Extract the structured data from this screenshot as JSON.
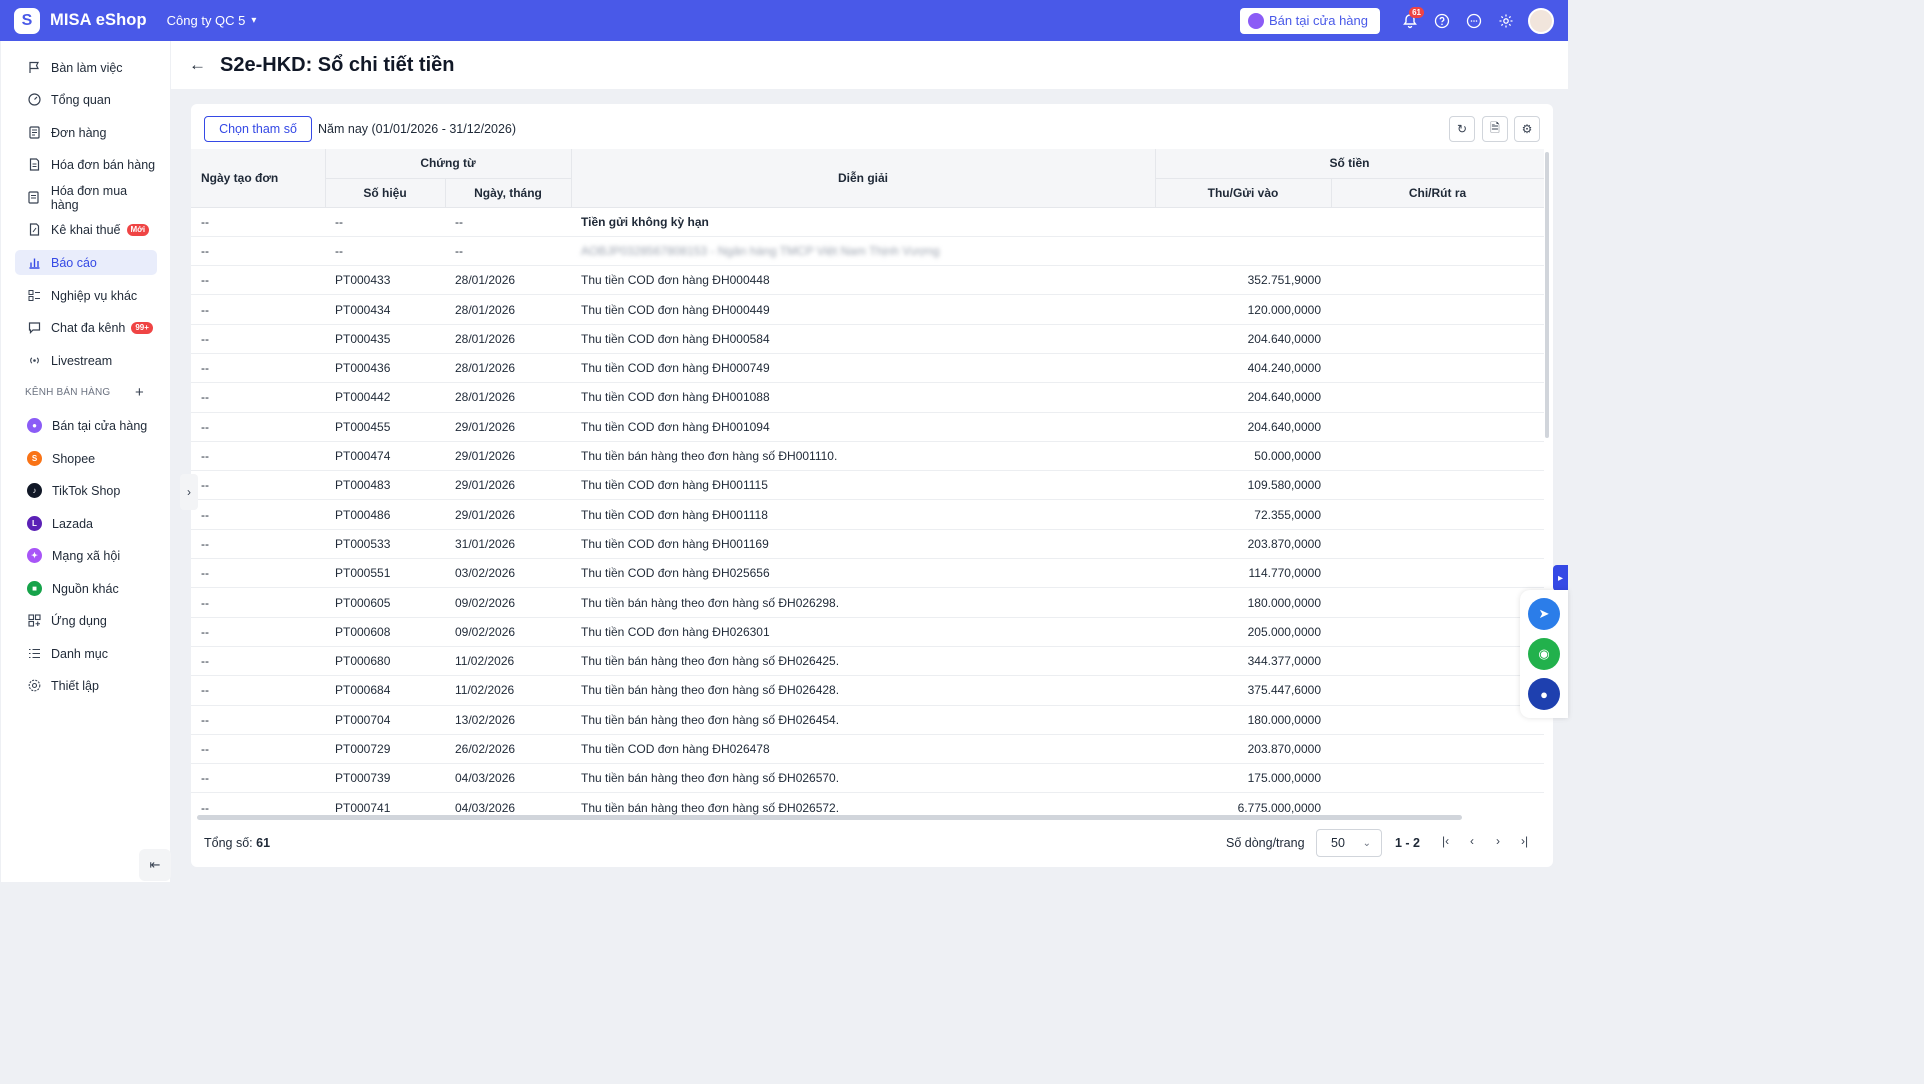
{
  "app": {
    "name": "MISA eShop",
    "company": "Công ty QC 5",
    "store_button": "Bán tại cửa hàng",
    "notif_count": "61"
  },
  "sidebar": {
    "items": [
      {
        "label": "Bàn làm việc"
      },
      {
        "label": "Tổng quan"
      },
      {
        "label": "Đơn hàng"
      },
      {
        "label": "Hóa đơn bán hàng"
      },
      {
        "label": "Hóa đơn mua hàng"
      },
      {
        "label": "Kê khai thuế",
        "badge": "Mới"
      },
      {
        "label": "Báo cáo"
      },
      {
        "label": "Nghiệp vụ khác"
      },
      {
        "label": "Chat đa kênh",
        "badge": "99+"
      },
      {
        "label": "Livestream"
      }
    ],
    "section_label": "KÊNH BÁN HÀNG",
    "channels": [
      {
        "label": "Bán tại cửa hàng",
        "color": "#8b5cf6"
      },
      {
        "label": "Shopee",
        "color": "#f97316"
      },
      {
        "label": "TikTok Shop",
        "color": "#111827"
      },
      {
        "label": "Lazada",
        "color": "#5b21b6"
      },
      {
        "label": "Mạng xã hội",
        "color": "#a855f7"
      },
      {
        "label": "Nguồn khác",
        "color": "#16a34a"
      }
    ],
    "bottom_items": [
      {
        "label": "Ứng dụng"
      },
      {
        "label": "Danh mục"
      },
      {
        "label": "Thiết lập"
      }
    ]
  },
  "page": {
    "title": "S2e-HKD: Sổ chi tiết tiền",
    "param_button": "Chọn tham số",
    "period": "Năm nay (01/01/2026 - 31/12/2026)"
  },
  "table": {
    "headers": {
      "date_created": "Ngày tạo đơn",
      "voucher": "Chứng từ",
      "voucher_no": "Số hiệu",
      "voucher_date": "Ngày, tháng",
      "description": "Diễn giải",
      "amount": "Số tiền",
      "income": "Thu/Gửi vào",
      "expense": "Chi/Rút ra"
    },
    "rows": [
      {
        "c1": "--",
        "c2": "--",
        "c3": "--",
        "c4": "Tiền gửi không kỳ hạn",
        "c5": "",
        "c6": ""
      },
      {
        "c1": "--",
        "c2": "--",
        "c3": "--",
        "c4": "AOBJP0328567808153 - Ngân hàng TMCP Việt Nam Thịnh Vượng",
        "c5": "",
        "c6": ""
      },
      {
        "c1": "--",
        "c2": "PT000433",
        "c3": "28/01/2026",
        "c4": "Thu tiền COD đơn hàng ĐH000448",
        "c5": "352.751,9000",
        "c6": ""
      },
      {
        "c1": "--",
        "c2": "PT000434",
        "c3": "28/01/2026",
        "c4": "Thu tiền COD đơn hàng ĐH000449",
        "c5": "120.000,0000",
        "c6": ""
      },
      {
        "c1": "--",
        "c2": "PT000435",
        "c3": "28/01/2026",
        "c4": "Thu tiền COD đơn hàng ĐH000584",
        "c5": "204.640,0000",
        "c6": ""
      },
      {
        "c1": "--",
        "c2": "PT000436",
        "c3": "28/01/2026",
        "c4": "Thu tiền COD đơn hàng ĐH000749",
        "c5": "404.240,0000",
        "c6": ""
      },
      {
        "c1": "--",
        "c2": "PT000442",
        "c3": "28/01/2026",
        "c4": "Thu tiền COD đơn hàng ĐH001088",
        "c5": "204.640,0000",
        "c6": ""
      },
      {
        "c1": "--",
        "c2": "PT000455",
        "c3": "29/01/2026",
        "c4": "Thu tiền COD đơn hàng ĐH001094",
        "c5": "204.640,0000",
        "c6": ""
      },
      {
        "c1": "--",
        "c2": "PT000474",
        "c3": "29/01/2026",
        "c4": "Thu tiền bán hàng theo đơn hàng số ĐH001110.",
        "c5": "50.000,0000",
        "c6": ""
      },
      {
        "c1": "--",
        "c2": "PT000483",
        "c3": "29/01/2026",
        "c4": "Thu tiền COD đơn hàng ĐH001115",
        "c5": "109.580,0000",
        "c6": ""
      },
      {
        "c1": "--",
        "c2": "PT000486",
        "c3": "29/01/2026",
        "c4": "Thu tiền COD đơn hàng ĐH001118",
        "c5": "72.355,0000",
        "c6": ""
      },
      {
        "c1": "--",
        "c2": "PT000533",
        "c3": "31/01/2026",
        "c4": "Thu tiền COD đơn hàng ĐH001169",
        "c5": "203.870,0000",
        "c6": ""
      },
      {
        "c1": "--",
        "c2": "PT000551",
        "c3": "03/02/2026",
        "c4": "Thu tiền COD đơn hàng ĐH025656",
        "c5": "114.770,0000",
        "c6": ""
      },
      {
        "c1": "--",
        "c2": "PT000605",
        "c3": "09/02/2026",
        "c4": "Thu tiền bán hàng theo đơn hàng số ĐH026298.",
        "c5": "180.000,0000",
        "c6": ""
      },
      {
        "c1": "--",
        "c2": "PT000608",
        "c3": "09/02/2026",
        "c4": "Thu tiền COD đơn hàng ĐH026301",
        "c5": "205.000,0000",
        "c6": ""
      },
      {
        "c1": "--",
        "c2": "PT000680",
        "c3": "11/02/2026",
        "c4": "Thu tiền bán hàng theo đơn hàng số ĐH026425.",
        "c5": "344.377,0000",
        "c6": ""
      },
      {
        "c1": "--",
        "c2": "PT000684",
        "c3": "11/02/2026",
        "c4": "Thu tiền bán hàng theo đơn hàng số ĐH026428.",
        "c5": "375.447,6000",
        "c6": ""
      },
      {
        "c1": "--",
        "c2": "PT000704",
        "c3": "13/02/2026",
        "c4": "Thu tiền bán hàng theo đơn hàng số ĐH026454.",
        "c5": "180.000,0000",
        "c6": ""
      },
      {
        "c1": "--",
        "c2": "PT000729",
        "c3": "26/02/2026",
        "c4": "Thu tiền COD đơn hàng ĐH026478",
        "c5": "203.870,0000",
        "c6": ""
      },
      {
        "c1": "--",
        "c2": "PT000739",
        "c3": "04/03/2026",
        "c4": "Thu tiền bán hàng theo đơn hàng số ĐH026570.",
        "c5": "175.000,0000",
        "c6": ""
      },
      {
        "c1": "--",
        "c2": "PT000741",
        "c3": "04/03/2026",
        "c4": "Thu tiền bán hàng theo đơn hàng số ĐH026572.",
        "c5": "6.775.000,0000",
        "c6": ""
      }
    ]
  },
  "footer": {
    "total_label": "Tổng số:",
    "total_value": "61",
    "rows_per_page_label": "Số dòng/trang",
    "rows_per_page_value": "50",
    "page_range": "1 - 2"
  }
}
